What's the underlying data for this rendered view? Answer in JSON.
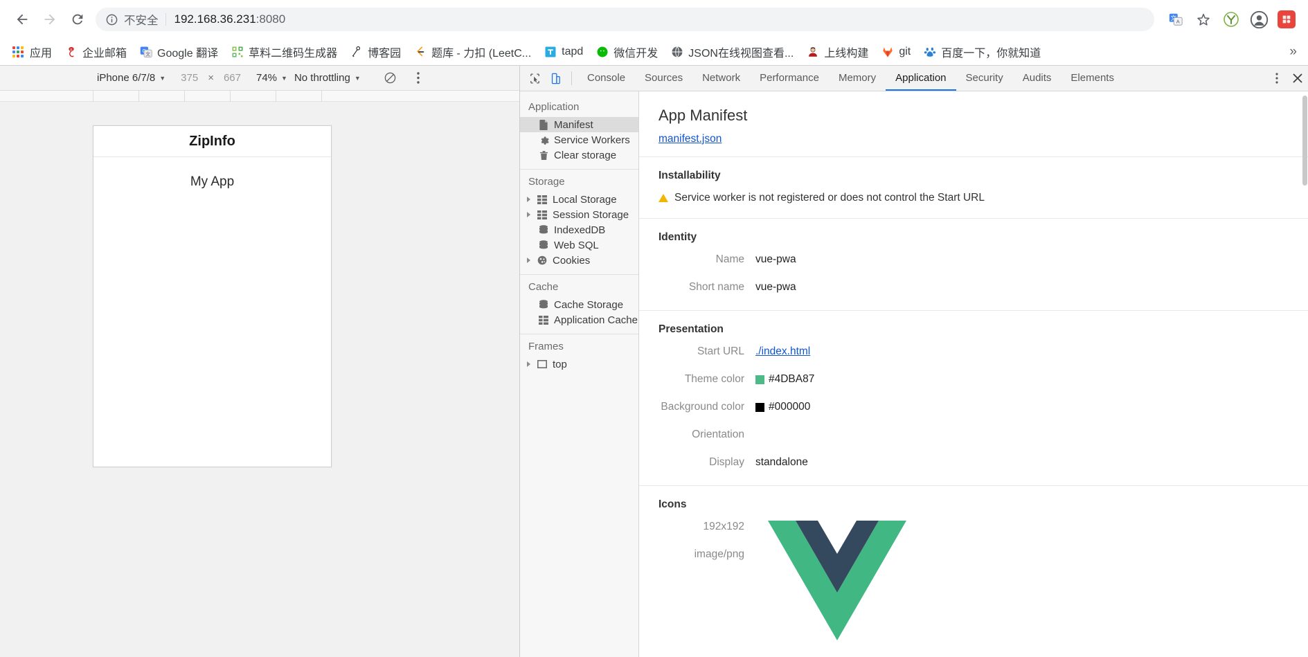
{
  "browser": {
    "nav": {
      "back": "back-arrow",
      "forward": "forward-arrow",
      "reload": "reload"
    },
    "omnibox": {
      "security_label": "不安全",
      "url_host": "192.168.36.231",
      "url_port": ":8080",
      "info_icon": "info-circle-icon"
    },
    "toolbar_icons": [
      "translate-icon",
      "star-icon",
      "extension-y-icon",
      "profile-avatar",
      "extension-red-icon"
    ],
    "bookmarks": [
      {
        "label": "应用",
        "icon": "apps-grid-icon"
      },
      {
        "label": "企业邮箱",
        "icon": "netease-mail-icon"
      },
      {
        "label": "Google 翻译",
        "icon": "google-translate-icon"
      },
      {
        "label": "草料二维码生成器",
        "icon": "qrcode-icon"
      },
      {
        "label": "博客园",
        "icon": "cnblogs-icon"
      },
      {
        "label": "题库 - 力扣 (LeetC...",
        "icon": "leetcode-icon"
      },
      {
        "label": "tapd",
        "icon": "tapd-icon"
      },
      {
        "label": "微信开发",
        "icon": "wechat-icon"
      },
      {
        "label": "JSON在线视图查看...",
        "icon": "globe-icon"
      },
      {
        "label": "上线构建",
        "icon": "person-icon"
      },
      {
        "label": "git",
        "icon": "gitlab-icon"
      },
      {
        "label": "百度一下，你就知道",
        "icon": "baidu-icon"
      }
    ],
    "bookmarks_overflow": "»"
  },
  "device_toolbar": {
    "device": "iPhone 6/7/8",
    "width": "375",
    "height": "667",
    "separator": "×",
    "zoom": "74%",
    "throttling": "No throttling",
    "rotate_icon": "rotate-icon",
    "menu_icon": "kebab-menu-icon"
  },
  "device_preview": {
    "app_title": "ZipInfo",
    "app_body": "My App"
  },
  "devtools": {
    "tools": [
      "inspect-element-icon",
      "toggle-device-toolbar-icon"
    ],
    "tabs": [
      {
        "label": "Console",
        "active": false
      },
      {
        "label": "Sources",
        "active": false
      },
      {
        "label": "Network",
        "active": false
      },
      {
        "label": "Performance",
        "active": false
      },
      {
        "label": "Memory",
        "active": false
      },
      {
        "label": "Application",
        "active": true
      },
      {
        "label": "Security",
        "active": false
      },
      {
        "label": "Audits",
        "active": false
      },
      {
        "label": "Elements",
        "active": false
      }
    ],
    "kebab": "⋮",
    "close": "✕",
    "sidebar": {
      "groups": [
        {
          "title": "Application",
          "items": [
            {
              "label": "Manifest",
              "icon": "manifest-document-icon",
              "selected": true,
              "arrow": false
            },
            {
              "label": "Service Workers",
              "icon": "gear-icon",
              "selected": false,
              "arrow": false
            },
            {
              "label": "Clear storage",
              "icon": "trash-icon",
              "selected": false,
              "arrow": false
            }
          ]
        },
        {
          "title": "Storage",
          "items": [
            {
              "label": "Local Storage",
              "icon": "table-icon",
              "selected": false,
              "arrow": true
            },
            {
              "label": "Session Storage",
              "icon": "table-icon",
              "selected": false,
              "arrow": true
            },
            {
              "label": "IndexedDB",
              "icon": "database-icon",
              "selected": false,
              "arrow": false
            },
            {
              "label": "Web SQL",
              "icon": "database-icon",
              "selected": false,
              "arrow": false
            },
            {
              "label": "Cookies",
              "icon": "cookie-icon",
              "selected": false,
              "arrow": true
            }
          ]
        },
        {
          "title": "Cache",
          "items": [
            {
              "label": "Cache Storage",
              "icon": "database-icon",
              "selected": false,
              "arrow": false
            },
            {
              "label": "Application Cache",
              "icon": "table-icon",
              "selected": false,
              "arrow": false
            }
          ]
        },
        {
          "title": "Frames",
          "items": [
            {
              "label": "top",
              "icon": "frame-icon",
              "selected": false,
              "arrow": true
            }
          ]
        }
      ]
    },
    "manifest": {
      "title": "App Manifest",
      "link": "manifest.json",
      "installability": {
        "heading": "Installability",
        "warning": "Service worker is not registered or does not control the Start URL",
        "warning_icon": "warning-triangle-icon"
      },
      "identity": {
        "heading": "Identity",
        "rows": [
          {
            "key": "Name",
            "value": "vue-pwa"
          },
          {
            "key": "Short name",
            "value": "vue-pwa"
          }
        ]
      },
      "presentation": {
        "heading": "Presentation",
        "rows": [
          {
            "key": "Start URL",
            "value": "./index.html",
            "link": true
          },
          {
            "key": "Theme color",
            "value": "#4DBA87",
            "swatch": "#4DBA87"
          },
          {
            "key": "Background color",
            "value": "#000000",
            "swatch": "#000000"
          },
          {
            "key": "Orientation",
            "value": ""
          },
          {
            "key": "Display",
            "value": "standalone"
          }
        ]
      },
      "icons": {
        "heading": "Icons",
        "size": "192x192",
        "mime": "image/png",
        "preview_icon": "vue-logo-icon",
        "preview_colors": {
          "green": "#41B883",
          "navy": "#35495E"
        }
      }
    }
  }
}
